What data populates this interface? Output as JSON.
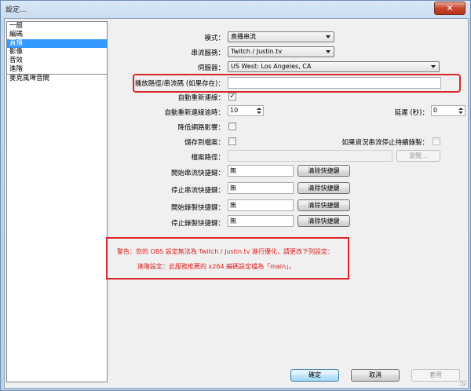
{
  "window": {
    "title": "設定...",
    "close_glyph": "✕"
  },
  "sidebar": {
    "items": [
      {
        "label": "一般"
      },
      {
        "label": "編碼"
      },
      {
        "label": "直播"
      },
      {
        "label": "影像"
      },
      {
        "label": "音效"
      },
      {
        "label": "進階"
      },
      {
        "label": "麥克風啤音閘"
      }
    ],
    "selected_index": 2
  },
  "form": {
    "mode": {
      "label": "模式：",
      "value": "直播串流"
    },
    "service": {
      "label": "串流服務：",
      "value": "Twitch / Justin.tv"
    },
    "server": {
      "label": "伺服器：",
      "value": "US West: Los Angeles, CA"
    },
    "play_path": {
      "label": "播放路徑/串流碼 (如果存在)：",
      "value": ""
    },
    "auto_reconnect": {
      "label": "自動重新連線：",
      "checked": true,
      "check_glyph": "✓"
    },
    "reconnect_timeout": {
      "label": "自動重新連線逾時：",
      "value": "10"
    },
    "delay": {
      "label": "延遲 (秒)：",
      "value": "0"
    },
    "low_latency": {
      "label": "降低網路影響：",
      "checked": false
    },
    "save_to_file": {
      "label": "儲存到檔案：",
      "checked": false
    },
    "keep_recording": {
      "label": "如果資況串流停止持續錄製：",
      "checked": false
    },
    "file_path": {
      "label": "檔案路徑：",
      "value": "",
      "browse_label": "瀏覽..."
    },
    "hotkeys": [
      {
        "label": "開始串流快捷鍵：",
        "value": "無",
        "clear_label": "清除快捷鍵"
      },
      {
        "label": "停止串流快捷鍵：",
        "value": "無",
        "clear_label": "清除快捷鍵"
      },
      {
        "label": "開始錄製快捷鍵：",
        "value": "無",
        "clear_label": "清除快捷鍵"
      },
      {
        "label": "停止錄製快捷鍵：",
        "value": "無",
        "clear_label": "清除快捷鍵"
      }
    ]
  },
  "warning": {
    "line1": "警告：您的 OBS 設定無法為 Twitch / Justin.tv 進行優化，請更改下列設定：",
    "line2": "進階設定：此服務推薦的 x264 編碼設定檔為「main」。"
  },
  "footer": {
    "ok_label": "確定",
    "cancel_label": "取消",
    "apply_label": "套用"
  },
  "colors": {
    "highlight": "#d9262b",
    "warning_text": "#e01a1a",
    "selection": "#3399ff"
  }
}
